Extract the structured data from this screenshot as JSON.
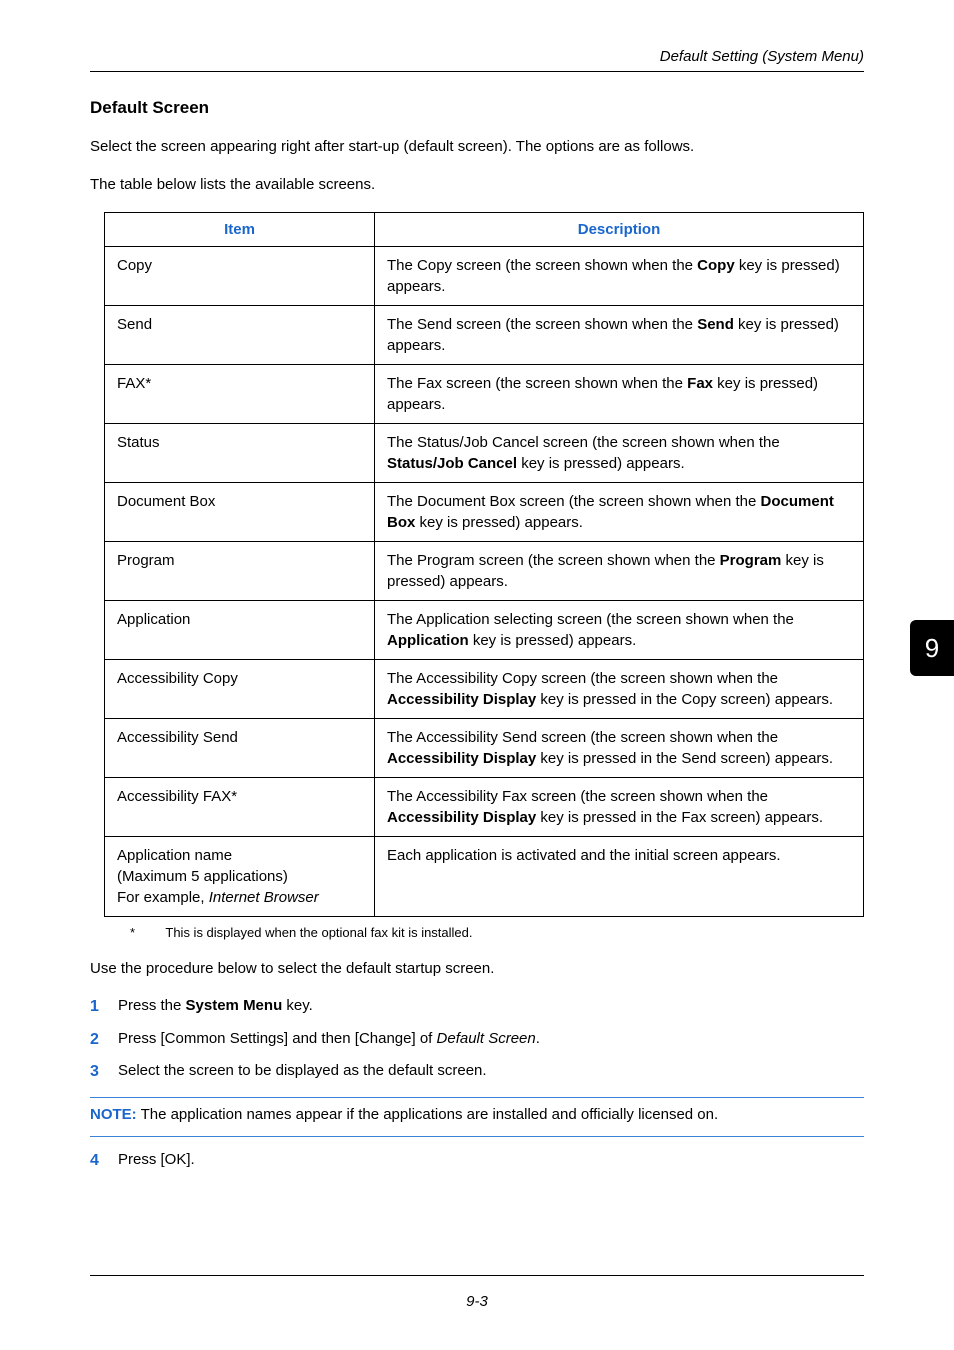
{
  "header": {
    "running_head": "Default Setting (System Menu)"
  },
  "section_title": "Default Screen",
  "intro": [
    "Select the screen appearing right after start-up (default screen). The options are as follows.",
    "The table below lists the available screens."
  ],
  "table": {
    "col1_header": "Item",
    "col2_header": "Description",
    "rows": [
      {
        "item": "Copy",
        "desc_pre": "The Copy screen (the screen shown when the ",
        "desc_bold": "Copy",
        "desc_post": " key is pressed) appears."
      },
      {
        "item": "Send",
        "desc_pre": "The Send screen (the screen shown when the ",
        "desc_bold": "Send",
        "desc_post": " key is pressed) appears."
      },
      {
        "item": "FAX*",
        "desc_pre": "The Fax screen (the screen shown when the ",
        "desc_bold": "Fax",
        "desc_post": " key is pressed) appears."
      },
      {
        "item": "Status",
        "desc_pre": "The Status/Job Cancel screen (the screen shown when the ",
        "desc_bold": "Status/Job Cancel",
        "desc_post": " key is pressed) appears."
      },
      {
        "item": "Document Box",
        "desc_pre": "The Document Box screen (the screen shown when the ",
        "desc_bold": "Document Box",
        "desc_post": " key is pressed) appears."
      },
      {
        "item": "Program",
        "desc_pre": "The Program screen (the screen shown when the ",
        "desc_bold": "Program",
        "desc_post": " key is pressed) appears."
      },
      {
        "item": "Application",
        "desc_pre": "The Application selecting screen (the screen shown when the ",
        "desc_bold": "Application",
        "desc_post": " key is pressed) appears."
      },
      {
        "item": "Accessibility Copy",
        "desc_pre": "The Accessibility Copy screen (the screen shown when the ",
        "desc_bold": "Accessibility Display",
        "desc_post": " key is pressed in the Copy screen) appears."
      },
      {
        "item": "Accessibility Send",
        "desc_pre": "The Accessibility Send screen (the screen shown when the ",
        "desc_bold": "Accessibility Display",
        "desc_post": " key is pressed in the Send screen) appears."
      },
      {
        "item": "Accessibility FAX*",
        "desc_pre": "The Accessibility Fax screen (the screen shown when the ",
        "desc_bold": "Accessibility Display",
        "desc_post": " key is pressed in the Fax screen) appears."
      },
      {
        "item_l1": "Application name",
        "item_l2": "(Maximum 5 applications)",
        "item_l3_pre": "For example, ",
        "item_l3_ital": "Internet Browser",
        "desc_plain": "Each application is activated and the initial screen appears."
      }
    ]
  },
  "footnote": {
    "marker": "*",
    "text": "This is displayed when the optional fax kit is installed."
  },
  "after_table": "Use the procedure below to select the default startup screen.",
  "steps": {
    "s1_pre": "Press the ",
    "s1_bold": "System Menu",
    "s1_post": " key.",
    "s2_pre": "Press [Common Settings] and then [Change] of ",
    "s2_ital": "Default Screen",
    "s2_post": ".",
    "s3": "Select the screen to be displayed as the default screen.",
    "s4": "Press [OK]."
  },
  "note": {
    "label": "NOTE:",
    "text": " The application names appear if the applications are installed and officially licensed on."
  },
  "page_number": "9-3",
  "side_tab": "9"
}
